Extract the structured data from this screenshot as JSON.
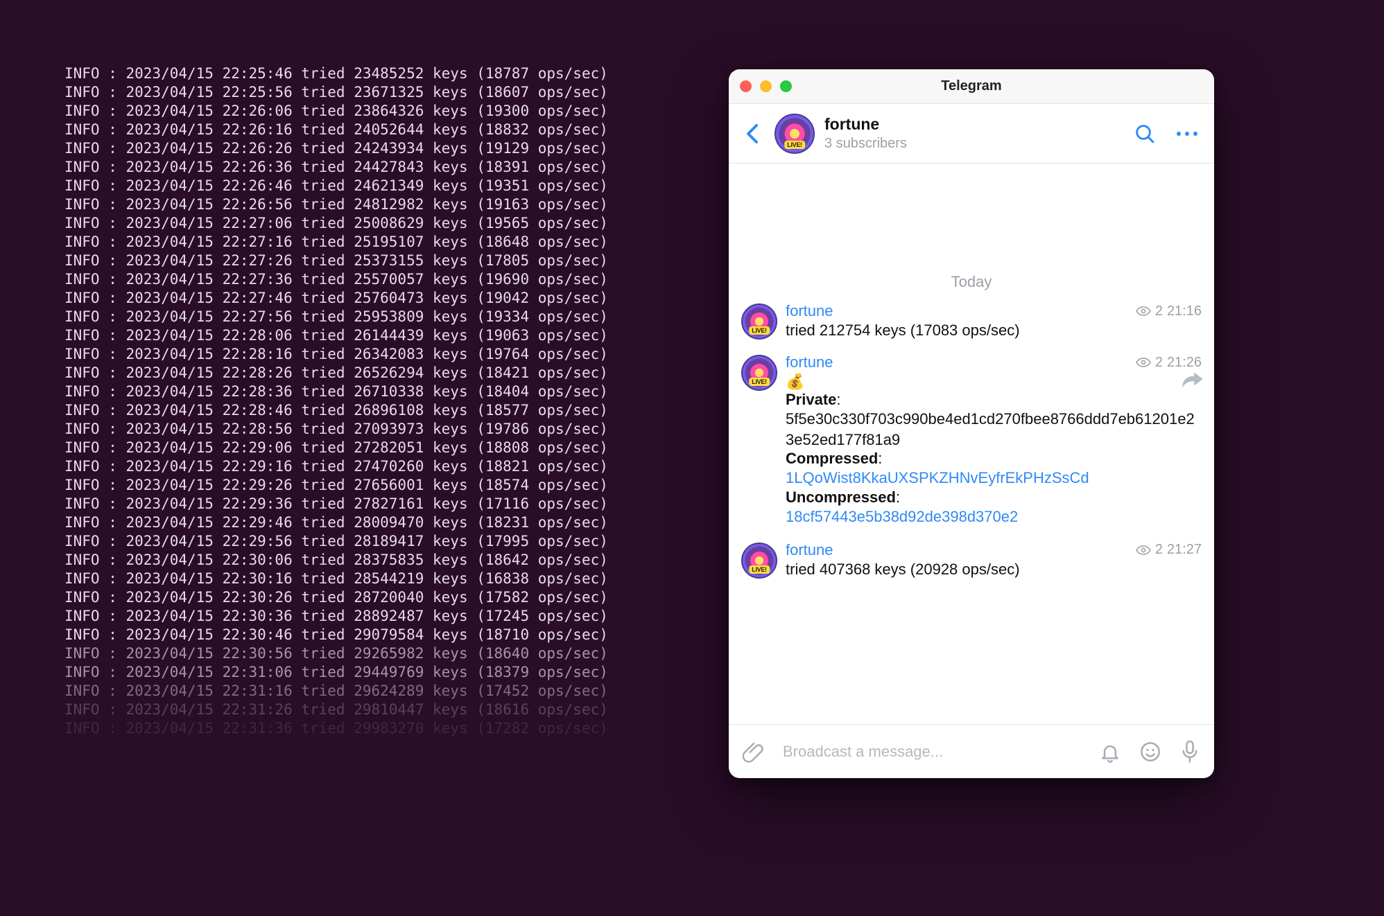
{
  "terminal": {
    "lines": [
      {
        "time": "22:25:46",
        "keys": "23485252",
        "ops": "18787"
      },
      {
        "time": "22:25:56",
        "keys": "23671325",
        "ops": "18607"
      },
      {
        "time": "22:26:06",
        "keys": "23864326",
        "ops": "19300"
      },
      {
        "time": "22:26:16",
        "keys": "24052644",
        "ops": "18832"
      },
      {
        "time": "22:26:26",
        "keys": "24243934",
        "ops": "19129"
      },
      {
        "time": "22:26:36",
        "keys": "24427843",
        "ops": "18391"
      },
      {
        "time": "22:26:46",
        "keys": "24621349",
        "ops": "19351"
      },
      {
        "time": "22:26:56",
        "keys": "24812982",
        "ops": "19163"
      },
      {
        "time": "22:27:06",
        "keys": "25008629",
        "ops": "19565"
      },
      {
        "time": "22:27:16",
        "keys": "25195107",
        "ops": "18648"
      },
      {
        "time": "22:27:26",
        "keys": "25373155",
        "ops": "17805"
      },
      {
        "time": "22:27:36",
        "keys": "25570057",
        "ops": "19690"
      },
      {
        "time": "22:27:46",
        "keys": "25760473",
        "ops": "19042"
      },
      {
        "time": "22:27:56",
        "keys": "25953809",
        "ops": "19334"
      },
      {
        "time": "22:28:06",
        "keys": "26144439",
        "ops": "19063"
      },
      {
        "time": "22:28:16",
        "keys": "26342083",
        "ops": "19764"
      },
      {
        "time": "22:28:26",
        "keys": "26526294",
        "ops": "18421"
      },
      {
        "time": "22:28:36",
        "keys": "26710338",
        "ops": "18404"
      },
      {
        "time": "22:28:46",
        "keys": "26896108",
        "ops": "18577"
      },
      {
        "time": "22:28:56",
        "keys": "27093973",
        "ops": "19786"
      },
      {
        "time": "22:29:06",
        "keys": "27282051",
        "ops": "18808"
      },
      {
        "time": "22:29:16",
        "keys": "27470260",
        "ops": "18821"
      },
      {
        "time": "22:29:26",
        "keys": "27656001",
        "ops": "18574"
      },
      {
        "time": "22:29:36",
        "keys": "27827161",
        "ops": "17116"
      },
      {
        "time": "22:29:46",
        "keys": "28009470",
        "ops": "18231"
      },
      {
        "time": "22:29:56",
        "keys": "28189417",
        "ops": "17995"
      },
      {
        "time": "22:30:06",
        "keys": "28375835",
        "ops": "18642"
      },
      {
        "time": "22:30:16",
        "keys": "28544219",
        "ops": "16838"
      },
      {
        "time": "22:30:26",
        "keys": "28720040",
        "ops": "17582"
      },
      {
        "time": "22:30:36",
        "keys": "28892487",
        "ops": "17245"
      },
      {
        "time": "22:30:46",
        "keys": "29079584",
        "ops": "18710"
      },
      {
        "time": "22:30:56",
        "keys": "29265982",
        "ops": "18640"
      },
      {
        "time": "22:31:06",
        "keys": "29449769",
        "ops": "18379"
      },
      {
        "time": "22:31:16",
        "keys": "29624289",
        "ops": "17452"
      },
      {
        "time": "22:31:26",
        "keys": "29810447",
        "ops": "18616"
      },
      {
        "time": "22:31:36",
        "keys": "29983270",
        "ops": "17282"
      }
    ],
    "date": "2023/04/15",
    "prefix": "INFO :"
  },
  "telegram": {
    "title": "Telegram",
    "channel_name": "fortune",
    "subscribers": "3 subscribers",
    "today_label": "Today",
    "messages": [
      {
        "from": "fortune",
        "views": "2",
        "time": "21:16",
        "text": "tried 212754 keys (17083 ops/sec)"
      },
      {
        "from": "fortune",
        "views": "2",
        "time": "21:26",
        "emoji": "💰",
        "private_label": "Private",
        "private_val": "5f5e30c330f703c990be4ed1cd270fbee8766ddd7eb61201e23e52ed177f81a9",
        "compressed_label": "Compressed",
        "compressed_val": "1LQoWist8KkaUXSPKZHNvEyfrEkPHzSsCd",
        "uncompressed_label": "Uncompressed",
        "uncompressed_val": "18cf57443e5b38d92de398d370e2"
      },
      {
        "from": "fortune",
        "views": "2",
        "time": "21:27",
        "text": "tried 407368 keys (20928 ops/sec)"
      }
    ],
    "composer_placeholder": "Broadcast a message..."
  }
}
